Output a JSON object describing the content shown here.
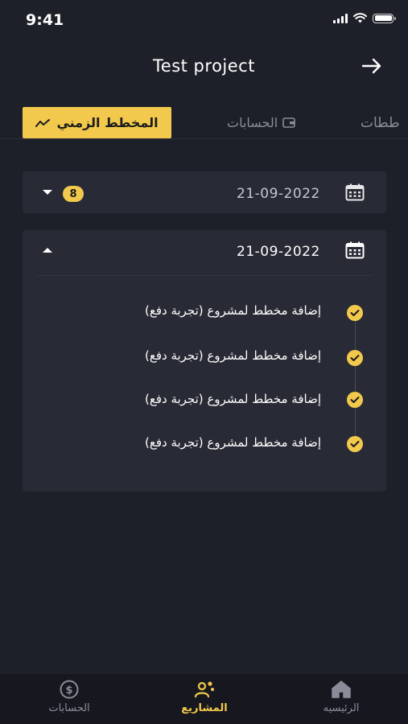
{
  "status_bar": {
    "time": "9:41"
  },
  "header": {
    "title": "Test project"
  },
  "tabs": {
    "timeline": "المخطط الزمني",
    "accounts": "الحسابات",
    "plans": "ططات"
  },
  "collapsed_group": {
    "date": "21-09-2022",
    "count": "8"
  },
  "expanded_group": {
    "date": "21-09-2022",
    "entries": [
      "إضافة مخطط لمشروع (تجربة دفع)",
      "إضافة مخطط لمشروع (تجربة دفع)",
      "إضافة مخطط لمشروع (تجربة دفع)",
      "إضافة مخطط لمشروع (تجربة دفع)"
    ]
  },
  "bottom_nav": {
    "accounts": "الحسابات",
    "projects": "المشاريع",
    "home": "الرئيسيه"
  },
  "colors": {
    "accent": "#f2c94c",
    "background": "#1e2029",
    "card": "#282a35",
    "muted": "#8a8c99"
  }
}
